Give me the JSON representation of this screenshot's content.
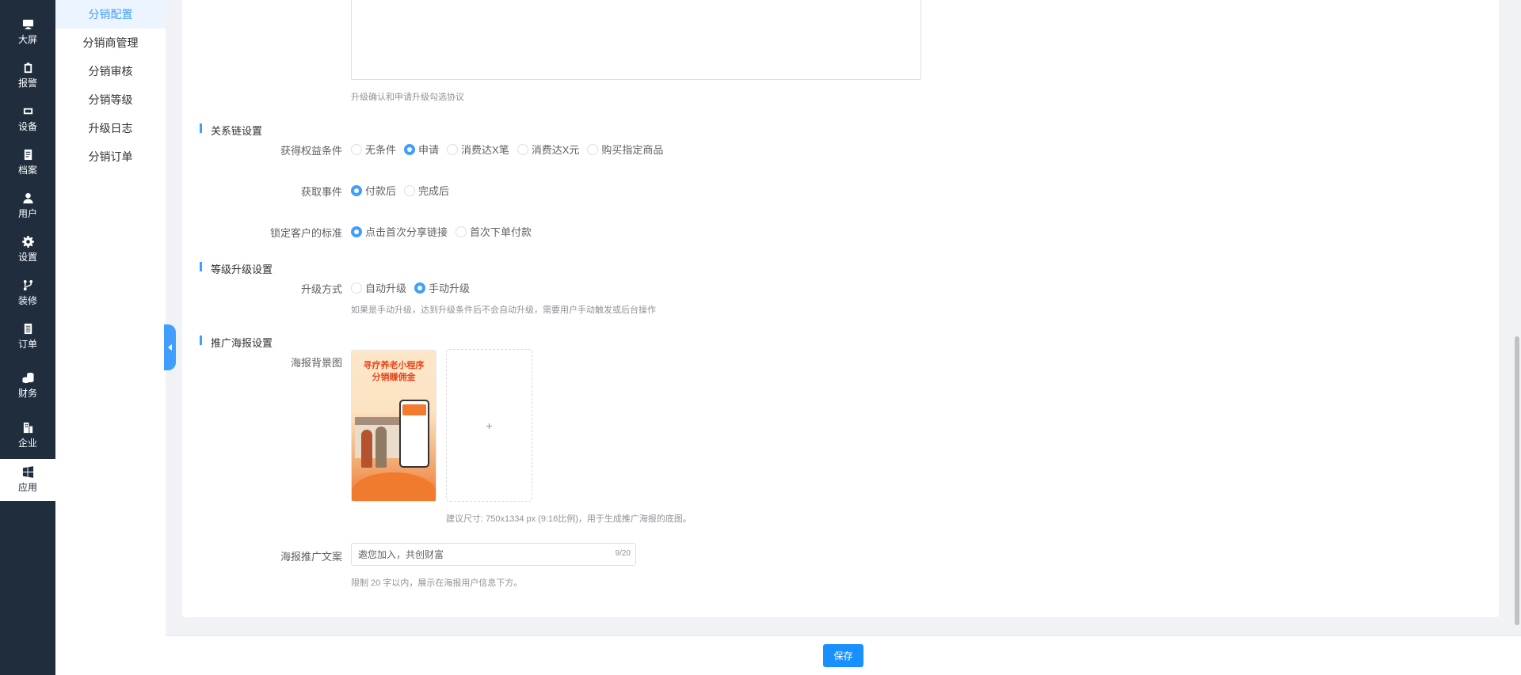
{
  "nav": [
    {
      "label": "大屏",
      "icon": "monitor-icon"
    },
    {
      "label": "报警",
      "icon": "clipboard-icon"
    },
    {
      "label": "设备",
      "icon": "device-icon"
    },
    {
      "label": "档案",
      "icon": "file-icon"
    },
    {
      "label": "用户",
      "icon": "user-icon"
    },
    {
      "label": "设置",
      "icon": "gear-icon"
    },
    {
      "label": "装修",
      "icon": "branch-icon"
    },
    {
      "label": "订单",
      "icon": "order-icon"
    },
    {
      "label": "财务",
      "icon": "coins-icon"
    },
    {
      "label": "企业",
      "icon": "building-icon"
    },
    {
      "label": "应用",
      "icon": "windows-icon",
      "active": true
    }
  ],
  "submenu": [
    {
      "label": "分销配置",
      "active": true
    },
    {
      "label": "分销商管理"
    },
    {
      "label": "分销审核"
    },
    {
      "label": "分销等级"
    },
    {
      "label": "升级日志"
    },
    {
      "label": "分销订单"
    }
  ],
  "form": {
    "agreement_hint": "升级确认和申请升级勾选协议",
    "relation_section": "关系链设置",
    "benefit_condition": {
      "label": "获得权益条件",
      "options": [
        "无条件",
        "申请",
        "消费达X笔",
        "消费达X元",
        "购买指定商品"
      ],
      "selected": "申请"
    },
    "acquire_event": {
      "label": "获取事件",
      "options": [
        "付款后",
        "完成后"
      ],
      "selected": "付款后"
    },
    "lock_standard": {
      "label": "锁定客户的标准",
      "options": [
        "点击首次分享链接",
        "首次下单付款"
      ],
      "selected": "点击首次分享链接"
    },
    "level_section": "等级升级设置",
    "upgrade_method": {
      "label": "升级方式",
      "options": [
        "自动升级",
        "手动升级"
      ],
      "selected": "手动升级"
    },
    "upgrade_hint": "如果是手动升级，达到升级条件后不会自动升级，需要用户手动触发或后台操作",
    "poster_section": "推广海报设置",
    "poster_bg_label": "海报背景图",
    "poster_thumb": {
      "title_line1": "寻疗养老小程序",
      "title_line2": "分销赚佣金"
    },
    "upload_plus": "+",
    "poster_size_hint": "建议尺寸: 750x1334 px (9:16比例)，用于生成推广海报的底图。",
    "poster_text_label": "海报推广文案",
    "poster_text_value": "邀您加入，共创财富",
    "poster_text_counter": "9/20",
    "poster_text_hint": "限制 20 字以内，展示在海报用户信息下方。"
  },
  "footer": {
    "save_label": "保存"
  },
  "colors": {
    "nav_bg": "#1f2d3d",
    "accent": "#409eff",
    "save_button": "#1890ff"
  }
}
